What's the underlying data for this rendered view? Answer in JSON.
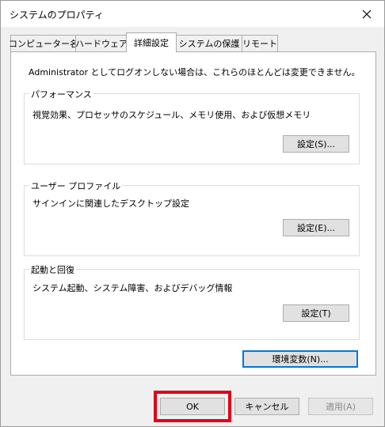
{
  "window": {
    "title": "システムのプロパティ"
  },
  "tabs": [
    {
      "label": "コンピューター名"
    },
    {
      "label": "ハードウェア"
    },
    {
      "label": "詳細設定"
    },
    {
      "label": "システムの保護"
    },
    {
      "label": "リモート"
    }
  ],
  "notice": "Administrator としてログオンしない場合は、これらのほとんどは変更できません。",
  "groups": {
    "performance": {
      "title": "パフォーマンス",
      "description": "視覚効果、プロセッサのスケジュール、メモリ使用、および仮想メモリ",
      "button": "設定(S)..."
    },
    "profile": {
      "title": "ユーザー プロファイル",
      "description": "サインインに関連したデスクトップ設定",
      "button": "設定(E)..."
    },
    "startup": {
      "title": "起動と回復",
      "description": "システム起動、システム障害、およびデバッグ情報",
      "button": "設定(T)"
    }
  },
  "env_button": "環境変数(N)...",
  "footer": {
    "ok": "OK",
    "cancel": "キャンセル",
    "apply": "適用(A)"
  },
  "colors": {
    "highlight": "#e0001a",
    "focus": "#0078d7"
  }
}
